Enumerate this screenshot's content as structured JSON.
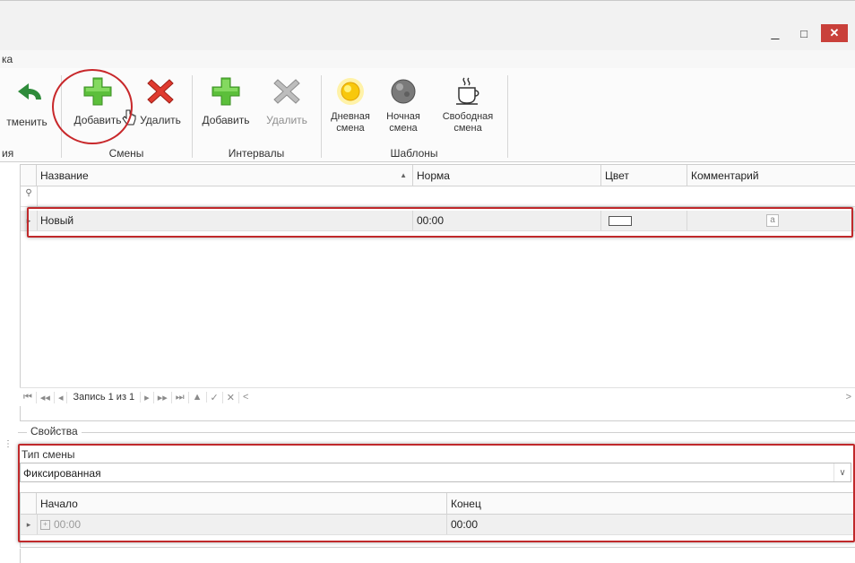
{
  "window": {
    "minimize": "_",
    "maximize": "□",
    "close": "✕"
  },
  "menu": {
    "tab_label": "ка"
  },
  "ribbon": {
    "cancel_label": "тменить",
    "cut_group_label": "ия",
    "shifts": {
      "add_label": "Добавить",
      "delete_label": "Удалить",
      "group_label": "Смены"
    },
    "intervals": {
      "add_label": "Добавить",
      "delete_label": "Удалить",
      "group_label": "Интервалы"
    },
    "templates": {
      "day_line1": "Дневная",
      "day_line2": "смена",
      "night_line1": "Ночная",
      "night_line2": "смена",
      "free_line1": "Свободная",
      "free_line2": "смена",
      "group_label": "Шаблоны"
    }
  },
  "grid": {
    "columns": [
      "Название",
      "Норма",
      "Цвет",
      "Комментарий"
    ],
    "rows": [
      {
        "name": "Новый",
        "norm": "00:00",
        "comment_icon": "a"
      }
    ],
    "navigator": {
      "first": "⏮",
      "prev_page": "◂◂",
      "prev": "◂",
      "record": "Запись 1 из 1",
      "next": "▸",
      "next_page": "▸▸",
      "last": "⏭",
      "add": "▲",
      "confirm": "✓",
      "cancel": "✕",
      "scroll": "<",
      "scroll_right": ">"
    }
  },
  "properties": {
    "caption": "Свойства",
    "type_label": "Тип смены",
    "type_value": "Фиксированная",
    "intervals": {
      "columns": [
        "Начало",
        "Конец"
      ],
      "rows": [
        {
          "start": "00:00",
          "end": "00:00"
        }
      ]
    }
  },
  "colors": {
    "annotation": "#c0292b",
    "close_button": "#c9403a"
  }
}
